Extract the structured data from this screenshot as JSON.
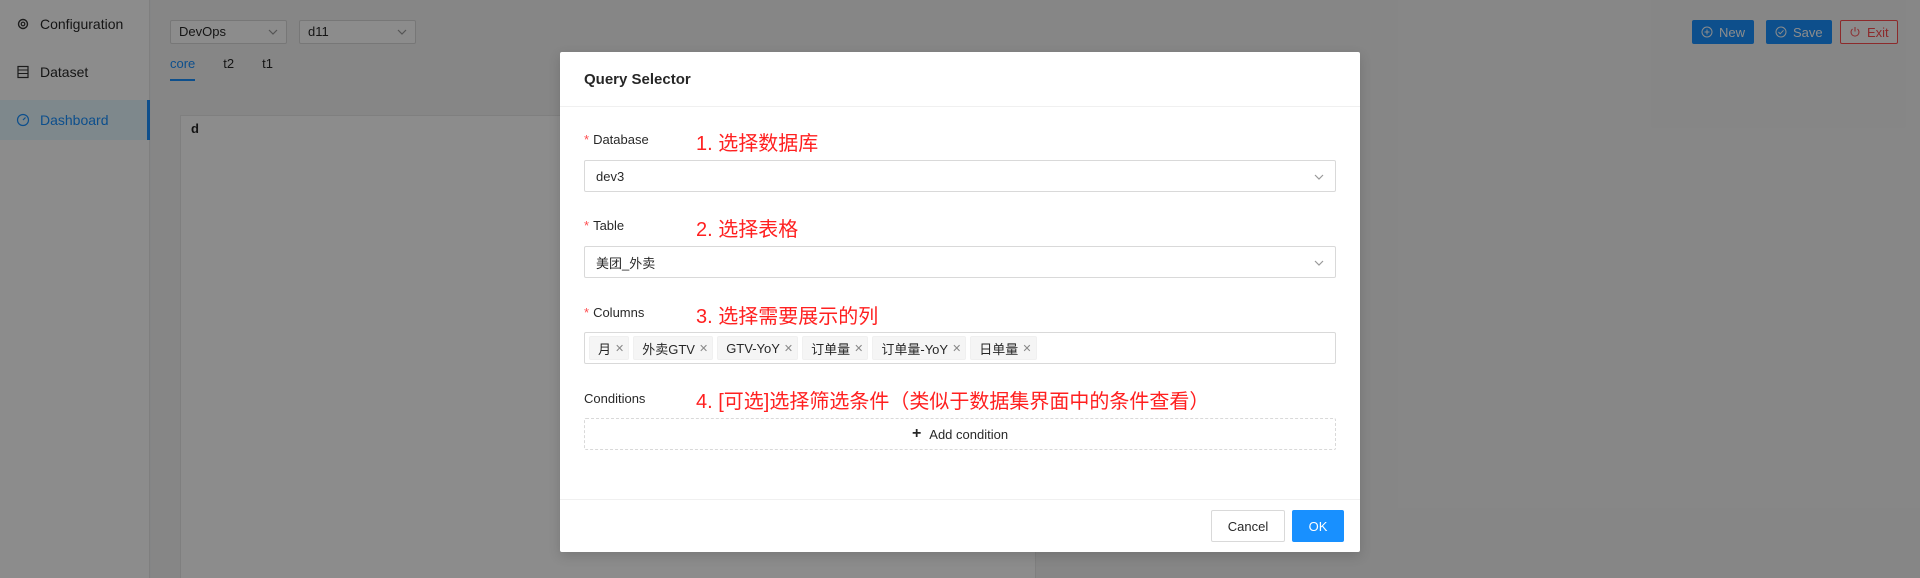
{
  "sidebar": {
    "items": [
      {
        "label": "Configuration",
        "icon": "gear-icon"
      },
      {
        "label": "Dataset",
        "icon": "table-icon"
      },
      {
        "label": "Dashboard",
        "icon": "dashboard-icon",
        "active": true
      }
    ]
  },
  "header": {
    "project_select": "DevOps",
    "dashboard_select": "d11",
    "tabs": [
      {
        "label": "core",
        "active": true
      },
      {
        "label": "t2"
      },
      {
        "label": "t1"
      }
    ],
    "new_label": "New",
    "save_label": "Save",
    "exit_label": "Exit"
  },
  "panel": {
    "title": "d"
  },
  "modal": {
    "title": "Query Selector",
    "database_label": "Database",
    "database_note": "1. 选择数据库",
    "database_value": "dev3",
    "table_label": "Table",
    "table_note": "2. 选择表格",
    "table_value": "美团_外卖",
    "columns_label": "Columns",
    "columns_note": "3. 选择需要展示的列",
    "columns": [
      "月",
      "外卖GTV",
      "GTV-YoY",
      "订单量",
      "订单量-YoY",
      "日单量"
    ],
    "conditions_label": "Conditions",
    "conditions_note": "4. [可选]选择筛选条件（类似于数据集界面中的条件查看）",
    "add_condition_label": "Add condition",
    "cancel_label": "Cancel",
    "ok_label": "OK"
  },
  "colors": {
    "primary": "#1890ff",
    "danger": "#ff4d4f",
    "annotation": "#ff2020"
  }
}
